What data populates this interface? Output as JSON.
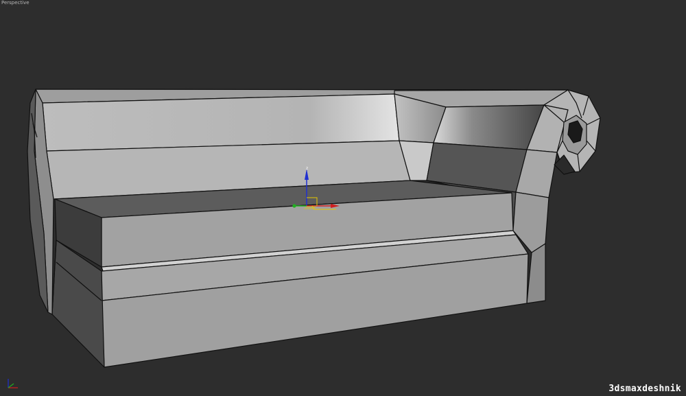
{
  "viewport": {
    "label": "Perspective"
  },
  "watermark": {
    "text": "3dsmaxdeshnik"
  },
  "gizmo": {
    "z_label": "z"
  },
  "colors": {
    "background": "#2d2d2d",
    "wire": "#101010",
    "gizmo_x": "#d02020",
    "gizmo_y": "#20b020",
    "gizmo_z": "#2030d0",
    "gizmo_plane": "#e6c800"
  }
}
